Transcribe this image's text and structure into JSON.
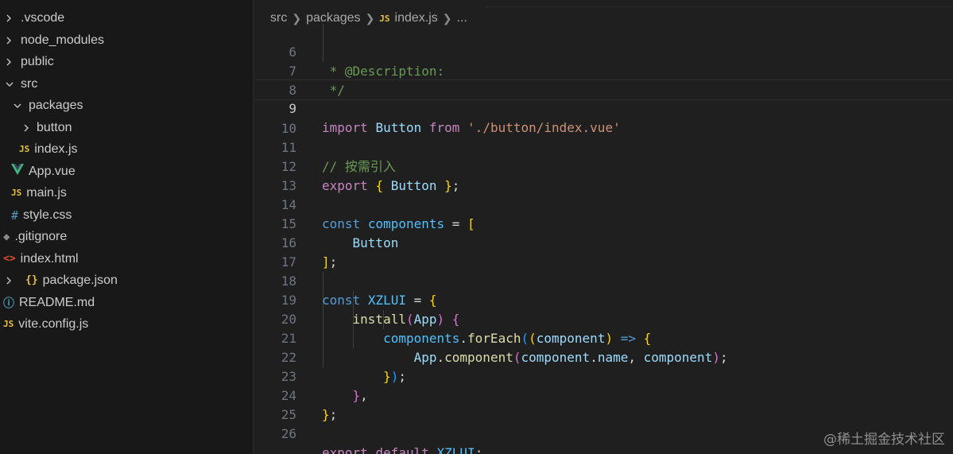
{
  "explorer": {
    "items": [
      {
        "label": ".vscode",
        "type": "folder",
        "expanded": false
      },
      {
        "label": "node_modules",
        "type": "folder",
        "expanded": false
      },
      {
        "label": "public",
        "type": "folder",
        "expanded": false
      },
      {
        "label": "src",
        "type": "folder",
        "expanded": true
      },
      {
        "label": "packages",
        "type": "folder",
        "expanded": true
      },
      {
        "label": "button",
        "type": "folder",
        "expanded": false
      },
      {
        "label": "index.js",
        "type": "file",
        "icon": "js-file-icon",
        "badge": "JS"
      },
      {
        "label": "App.vue",
        "type": "file",
        "icon": "vue-file-icon"
      },
      {
        "label": "main.js",
        "type": "file",
        "icon": "js-file-icon",
        "badge": "JS"
      },
      {
        "label": "style.css",
        "type": "file",
        "icon": "css-file-icon",
        "badge": "#"
      },
      {
        "label": ".gitignore",
        "type": "file",
        "icon": "git-file-icon",
        "badge": "◆"
      },
      {
        "label": "index.html",
        "type": "file",
        "icon": "html-file-icon",
        "badge": "<>"
      },
      {
        "label": "package.json",
        "type": "folder",
        "expanded": false,
        "badge": "{}"
      },
      {
        "label": "README.md",
        "type": "file",
        "icon": "info-file-icon",
        "badge": "ⓘ"
      },
      {
        "label": "vite.config.js",
        "type": "file",
        "icon": "js-file-icon",
        "badge": "JS"
      }
    ]
  },
  "breadcrumb": {
    "parts": [
      "src",
      "packages",
      "index.js",
      "..."
    ],
    "file_badge": "JS"
  },
  "editor": {
    "current_line": 9,
    "lines": [
      {
        "n": "6",
        "text": " * @Description:"
      },
      {
        "n": "7",
        "text": " */"
      },
      {
        "n": "8",
        "text": ""
      },
      {
        "n": "9",
        "text": "import Button from './button/index.vue'"
      },
      {
        "n": "10",
        "text": ""
      },
      {
        "n": "11",
        "text": "// 按需引入"
      },
      {
        "n": "12",
        "text": "export { Button };"
      },
      {
        "n": "13",
        "text": ""
      },
      {
        "n": "14",
        "text": "const components = ["
      },
      {
        "n": "15",
        "text": "    Button"
      },
      {
        "n": "16",
        "text": "];"
      },
      {
        "n": "17",
        "text": ""
      },
      {
        "n": "18",
        "text": "const XZLUI = {"
      },
      {
        "n": "19",
        "text": "    install(App) {"
      },
      {
        "n": "20",
        "text": "        components.forEach((component) => {"
      },
      {
        "n": "21",
        "text": "            App.component(component.name, component);"
      },
      {
        "n": "22",
        "text": "        });"
      },
      {
        "n": "23",
        "text": "    },"
      },
      {
        "n": "24",
        "text": "};"
      },
      {
        "n": "25",
        "text": ""
      },
      {
        "n": "26",
        "text": "export default XZLUI;"
      }
    ]
  },
  "watermark": "@稀土掘金技术社区",
  "colors": {
    "sidebar_bg": "#181818",
    "editor_bg": "#1f1f1f",
    "keyword": "#c586c0",
    "declaration": "#569cd6",
    "variable": "#9cdcfe",
    "constant": "#4fc1ff",
    "string": "#ce9178",
    "comment": "#6a9955",
    "function": "#dcdcaa"
  }
}
